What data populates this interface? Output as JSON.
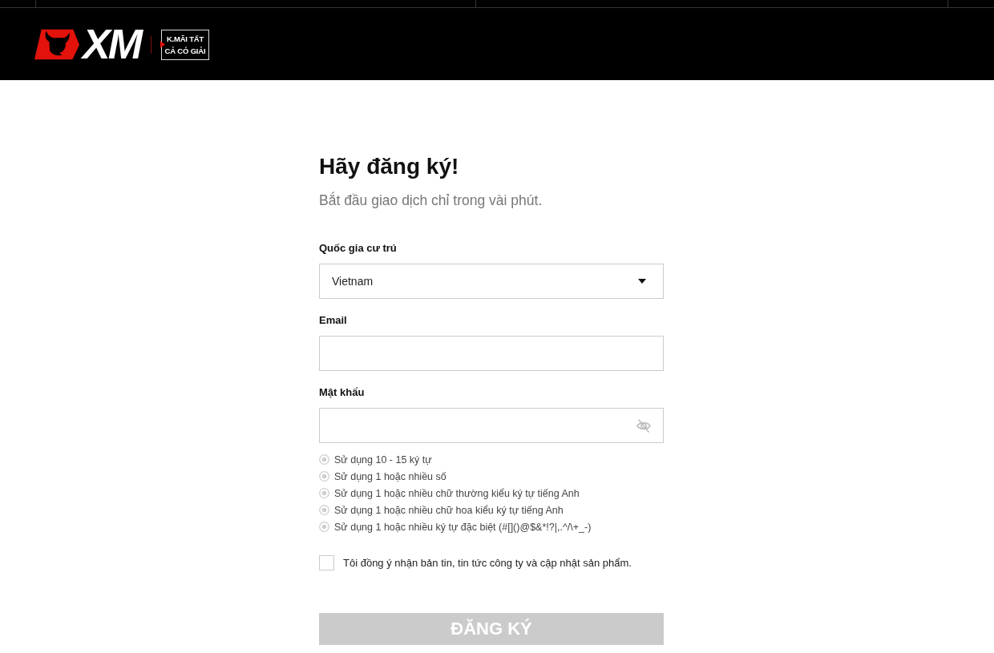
{
  "header": {
    "logo_text": "XM",
    "promo_lines": [
      "K.MÃI TẤT",
      "CẢ CÓ GIẢI"
    ]
  },
  "form": {
    "title": "Hãy đăng ký!",
    "subtitle": "Bắt đầu giao dịch chỉ trong vài phút.",
    "fields": [
      {
        "kind": "select",
        "label": "Quốc gia cư trú",
        "value": "Vietnam"
      },
      {
        "kind": "text",
        "label": "Email"
      },
      {
        "kind": "password",
        "label": "Mật khẩu"
      }
    ],
    "password_rules": [
      {
        "text": "Sử dụng 10 - 15 ký tự",
        "met": false
      },
      {
        "text": "Sử dụng 1 hoặc nhiều số",
        "met": false
      },
      {
        "text": "Sử dụng 1 hoặc nhiều chữ thường kiểu ký tự tiếng Anh",
        "met": false
      },
      {
        "text": "Sử dụng 1 hoặc nhiều chữ hoa kiểu ký tự tiếng Anh",
        "met": false
      },
      {
        "text": "Sử dụng 1 hoặc nhiều ký tự đặc biệt (#[]()@$&*!?|,.^/\\+_-)",
        "met": false
      }
    ],
    "newsletter": {
      "label": "Tôi đồng ý nhận bản tin, tin tức công ty và cập nhật sản phẩm.",
      "checked": false
    },
    "submit": {
      "label": "ĐĂNG KÝ",
      "disabled": true
    }
  }
}
